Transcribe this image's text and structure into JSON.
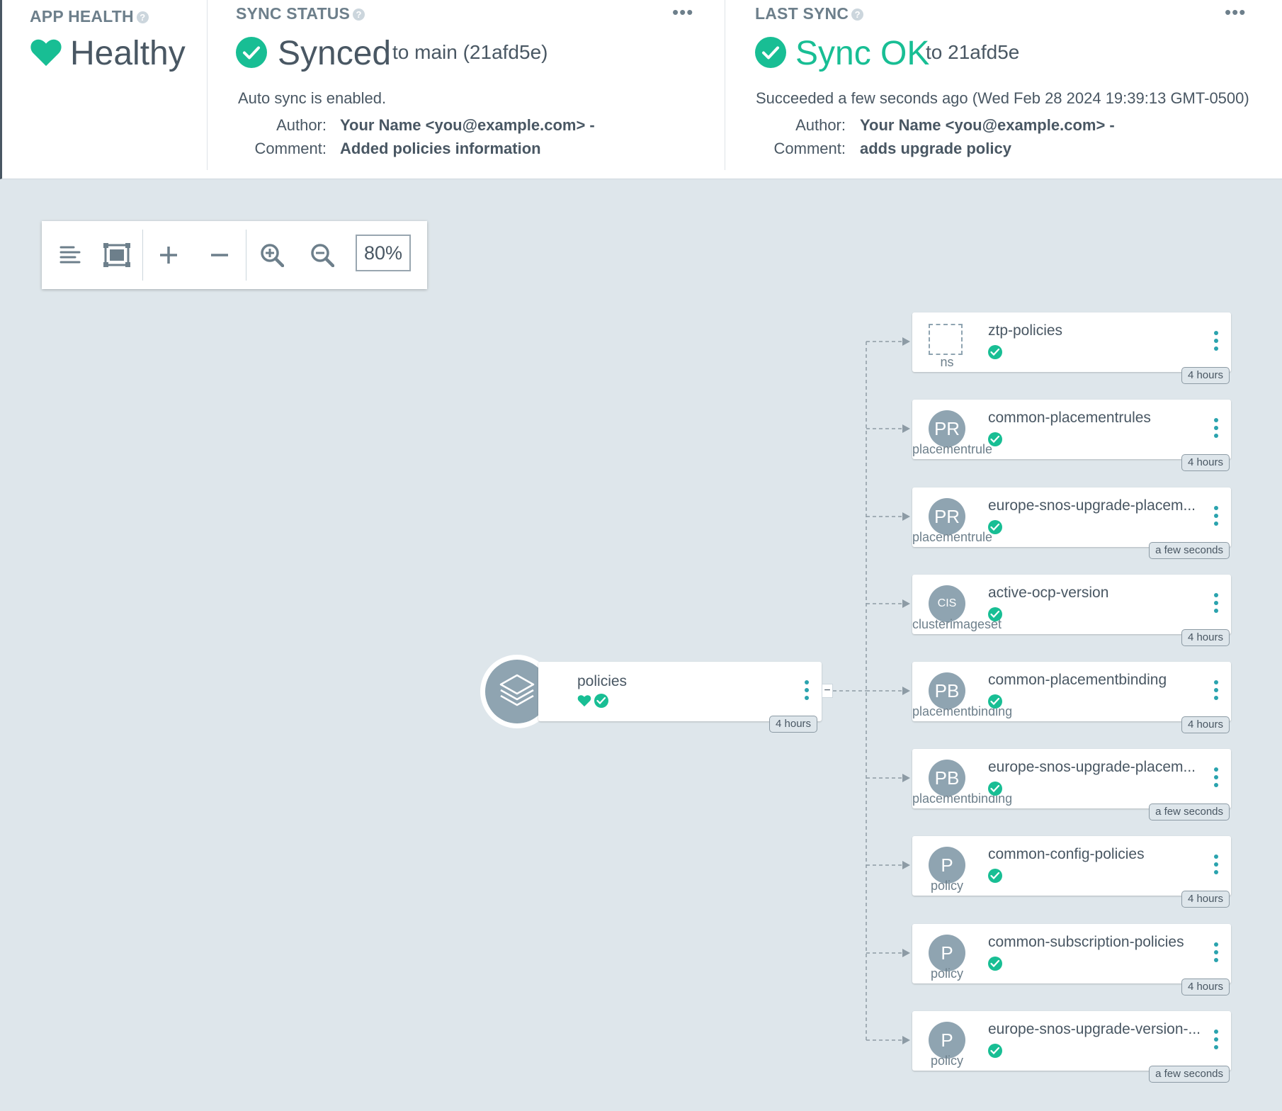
{
  "app_health": {
    "title": "APP HEALTH",
    "status": "Healthy",
    "help": "?"
  },
  "sync_status": {
    "title": "SYNC STATUS",
    "help": "?",
    "menu": "•••",
    "status": "Synced",
    "target": "to main (21afd5e)",
    "auto_sync": "Auto sync is enabled.",
    "author_label": "Author:",
    "author": "Your Name <you@example.com> -",
    "comment_label": "Comment:",
    "comment": "Added policies information"
  },
  "last_sync": {
    "title": "LAST SYNC",
    "help": "?",
    "menu": "•••",
    "status": "Sync OK",
    "target": "to 21afd5e",
    "result": "Succeeded a few seconds ago (Wed Feb 28 2024 19:39:13 GMT-0500)",
    "author_label": "Author:",
    "author": "Your Name <you@example.com> -",
    "comment_label": "Comment:",
    "comment": "adds upgrade policy"
  },
  "toolbar": {
    "zoom": "80%",
    "icons": [
      "list-icon",
      "fit-screen-icon",
      "plus-icon",
      "minus-icon",
      "zoom-in-icon",
      "zoom-out-icon"
    ]
  },
  "root_node": {
    "name": "policies",
    "age": "4 hours",
    "collapse": "−"
  },
  "nodes": [
    {
      "name": "ztp-policies",
      "icon": "",
      "kind": "ns",
      "age": "4 hours"
    },
    {
      "name": "common-placementrules",
      "icon": "PR",
      "kind": "placementrule",
      "age": "4 hours"
    },
    {
      "name": "europe-snos-upgrade-placem...",
      "icon": "PR",
      "kind": "placementrule",
      "age": "a few seconds"
    },
    {
      "name": "active-ocp-version",
      "icon": "CIS",
      "kind": "clusterimageset",
      "age": "4 hours"
    },
    {
      "name": "common-placementbinding",
      "icon": "PB",
      "kind": "placementbinding",
      "age": "4 hours"
    },
    {
      "name": "europe-snos-upgrade-placem...",
      "icon": "PB",
      "kind": "placementbinding",
      "age": "a few seconds"
    },
    {
      "name": "common-config-policies",
      "icon": "P",
      "kind": "policy",
      "age": "4 hours"
    },
    {
      "name": "common-subscription-policies",
      "icon": "P",
      "kind": "policy",
      "age": "4 hours"
    },
    {
      "name": "europe-snos-upgrade-version-...",
      "icon": "P",
      "kind": "policy",
      "age": "a few seconds"
    }
  ],
  "colors": {
    "healthy": "#18be94",
    "synced": "#18be94",
    "text": "#495763",
    "canvas": "#dee6eb"
  }
}
